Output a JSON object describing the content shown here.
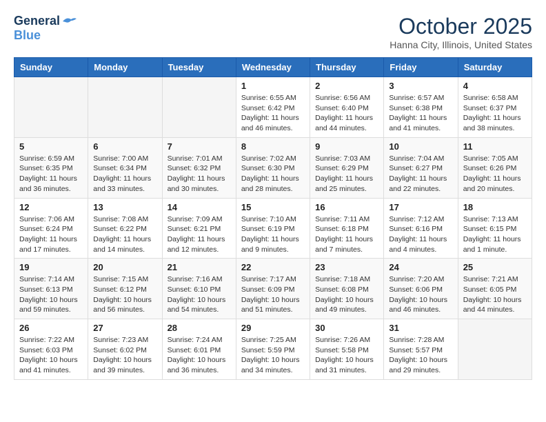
{
  "header": {
    "logo_line1": "General",
    "logo_line2": "Blue",
    "month": "October 2025",
    "location": "Hanna City, Illinois, United States"
  },
  "weekdays": [
    "Sunday",
    "Monday",
    "Tuesday",
    "Wednesday",
    "Thursday",
    "Friday",
    "Saturday"
  ],
  "weeks": [
    [
      {
        "day": "",
        "info": ""
      },
      {
        "day": "",
        "info": ""
      },
      {
        "day": "",
        "info": ""
      },
      {
        "day": "1",
        "info": "Sunrise: 6:55 AM\nSunset: 6:42 PM\nDaylight: 11 hours\nand 46 minutes."
      },
      {
        "day": "2",
        "info": "Sunrise: 6:56 AM\nSunset: 6:40 PM\nDaylight: 11 hours\nand 44 minutes."
      },
      {
        "day": "3",
        "info": "Sunrise: 6:57 AM\nSunset: 6:38 PM\nDaylight: 11 hours\nand 41 minutes."
      },
      {
        "day": "4",
        "info": "Sunrise: 6:58 AM\nSunset: 6:37 PM\nDaylight: 11 hours\nand 38 minutes."
      }
    ],
    [
      {
        "day": "5",
        "info": "Sunrise: 6:59 AM\nSunset: 6:35 PM\nDaylight: 11 hours\nand 36 minutes."
      },
      {
        "day": "6",
        "info": "Sunrise: 7:00 AM\nSunset: 6:34 PM\nDaylight: 11 hours\nand 33 minutes."
      },
      {
        "day": "7",
        "info": "Sunrise: 7:01 AM\nSunset: 6:32 PM\nDaylight: 11 hours\nand 30 minutes."
      },
      {
        "day": "8",
        "info": "Sunrise: 7:02 AM\nSunset: 6:30 PM\nDaylight: 11 hours\nand 28 minutes."
      },
      {
        "day": "9",
        "info": "Sunrise: 7:03 AM\nSunset: 6:29 PM\nDaylight: 11 hours\nand 25 minutes."
      },
      {
        "day": "10",
        "info": "Sunrise: 7:04 AM\nSunset: 6:27 PM\nDaylight: 11 hours\nand 22 minutes."
      },
      {
        "day": "11",
        "info": "Sunrise: 7:05 AM\nSunset: 6:26 PM\nDaylight: 11 hours\nand 20 minutes."
      }
    ],
    [
      {
        "day": "12",
        "info": "Sunrise: 7:06 AM\nSunset: 6:24 PM\nDaylight: 11 hours\nand 17 minutes."
      },
      {
        "day": "13",
        "info": "Sunrise: 7:08 AM\nSunset: 6:22 PM\nDaylight: 11 hours\nand 14 minutes."
      },
      {
        "day": "14",
        "info": "Sunrise: 7:09 AM\nSunset: 6:21 PM\nDaylight: 11 hours\nand 12 minutes."
      },
      {
        "day": "15",
        "info": "Sunrise: 7:10 AM\nSunset: 6:19 PM\nDaylight: 11 hours\nand 9 minutes."
      },
      {
        "day": "16",
        "info": "Sunrise: 7:11 AM\nSunset: 6:18 PM\nDaylight: 11 hours\nand 7 minutes."
      },
      {
        "day": "17",
        "info": "Sunrise: 7:12 AM\nSunset: 6:16 PM\nDaylight: 11 hours\nand 4 minutes."
      },
      {
        "day": "18",
        "info": "Sunrise: 7:13 AM\nSunset: 6:15 PM\nDaylight: 11 hours\nand 1 minute."
      }
    ],
    [
      {
        "day": "19",
        "info": "Sunrise: 7:14 AM\nSunset: 6:13 PM\nDaylight: 10 hours\nand 59 minutes."
      },
      {
        "day": "20",
        "info": "Sunrise: 7:15 AM\nSunset: 6:12 PM\nDaylight: 10 hours\nand 56 minutes."
      },
      {
        "day": "21",
        "info": "Sunrise: 7:16 AM\nSunset: 6:10 PM\nDaylight: 10 hours\nand 54 minutes."
      },
      {
        "day": "22",
        "info": "Sunrise: 7:17 AM\nSunset: 6:09 PM\nDaylight: 10 hours\nand 51 minutes."
      },
      {
        "day": "23",
        "info": "Sunrise: 7:18 AM\nSunset: 6:08 PM\nDaylight: 10 hours\nand 49 minutes."
      },
      {
        "day": "24",
        "info": "Sunrise: 7:20 AM\nSunset: 6:06 PM\nDaylight: 10 hours\nand 46 minutes."
      },
      {
        "day": "25",
        "info": "Sunrise: 7:21 AM\nSunset: 6:05 PM\nDaylight: 10 hours\nand 44 minutes."
      }
    ],
    [
      {
        "day": "26",
        "info": "Sunrise: 7:22 AM\nSunset: 6:03 PM\nDaylight: 10 hours\nand 41 minutes."
      },
      {
        "day": "27",
        "info": "Sunrise: 7:23 AM\nSunset: 6:02 PM\nDaylight: 10 hours\nand 39 minutes."
      },
      {
        "day": "28",
        "info": "Sunrise: 7:24 AM\nSunset: 6:01 PM\nDaylight: 10 hours\nand 36 minutes."
      },
      {
        "day": "29",
        "info": "Sunrise: 7:25 AM\nSunset: 5:59 PM\nDaylight: 10 hours\nand 34 minutes."
      },
      {
        "day": "30",
        "info": "Sunrise: 7:26 AM\nSunset: 5:58 PM\nDaylight: 10 hours\nand 31 minutes."
      },
      {
        "day": "31",
        "info": "Sunrise: 7:28 AM\nSunset: 5:57 PM\nDaylight: 10 hours\nand 29 minutes."
      },
      {
        "day": "",
        "info": ""
      }
    ]
  ]
}
